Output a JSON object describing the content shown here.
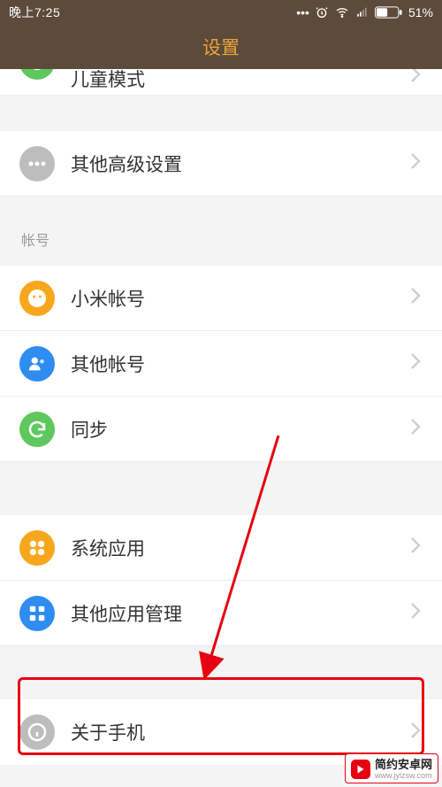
{
  "status": {
    "time": "晚上7:25",
    "battery": "51%"
  },
  "title": "设置",
  "partial_top": {
    "label": "儿童模式"
  },
  "rows_block1": [
    {
      "key": "advance",
      "label": "其他高级设置"
    }
  ],
  "section_account_label": "帐号",
  "rows_account": [
    {
      "key": "miacct",
      "label": "小米帐号"
    },
    {
      "key": "oacct",
      "label": "其他帐号"
    },
    {
      "key": "sync",
      "label": "同步"
    }
  ],
  "rows_apps": [
    {
      "key": "sysapp",
      "label": "系统应用"
    },
    {
      "key": "apps",
      "label": "其他应用管理"
    }
  ],
  "rows_about": [
    {
      "key": "about",
      "label": "关于手机"
    }
  ],
  "watermark": {
    "line1": "简约安卓网",
    "line2": "www.jylzsw.com"
  }
}
